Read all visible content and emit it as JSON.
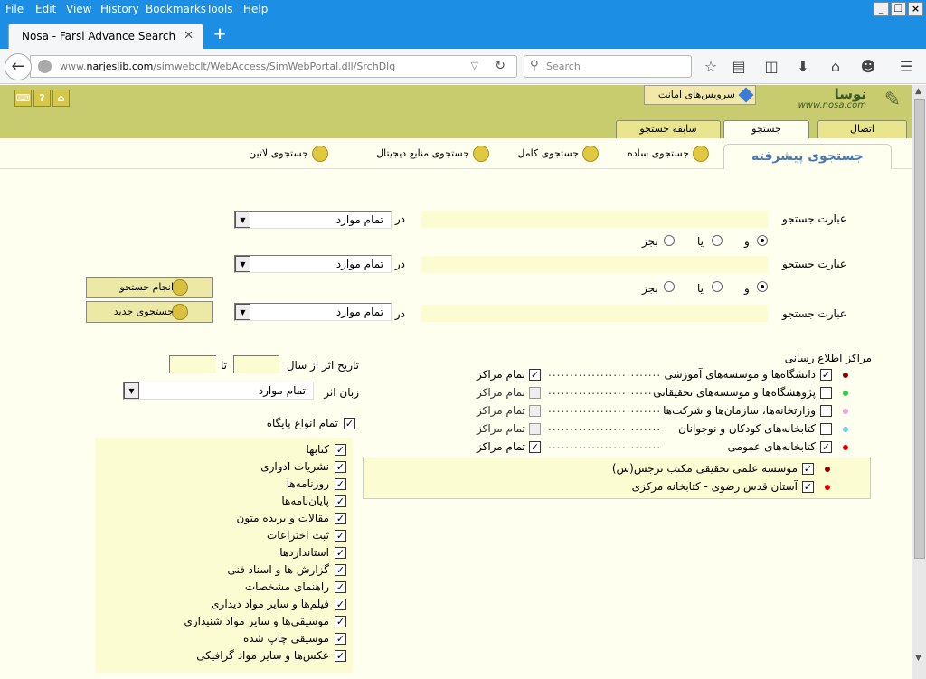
{
  "browser": {
    "menu": [
      "File",
      "Edit",
      "View",
      "History",
      "Bookmarks",
      "Tools",
      "Help"
    ],
    "tab_title": "Nosa - Farsi Advance Search",
    "url_prefix": "www.",
    "url_domain": "narjeslib.com",
    "url_path": "/simwebclt/WebAccess/SimWebPortal.dll/SrchDlg",
    "search_placeholder": "Search"
  },
  "header": {
    "services_button": "سرویس‌های امانت",
    "logo_name": "نوسا",
    "logo_url": "www.nosa.com"
  },
  "page_tabs": {
    "connect": "اتصال",
    "search": "جستجو",
    "history": "سابقه جستجو"
  },
  "advanced_title": "جستجوی پیشرفته",
  "search_links": {
    "simple": "جستجوی ساده",
    "full": "جستجوی کامل",
    "digital": "جستجوی منابع دیجیتال",
    "latin": "جستجوی لاتین"
  },
  "query": {
    "term_label": "عبارت جستجو",
    "in_label": "در",
    "field_value": "تمام موارد",
    "op_and": "و",
    "op_or": "یا",
    "op_not": "بجز"
  },
  "buttons": {
    "do_search": "انجام جستجو",
    "new_search": "جستجوی جدید"
  },
  "filters": {
    "date_label": "تاریخ اثر از سال",
    "to_label": "تا",
    "language_label": "زبان اثر",
    "language_value": "تمام موارد",
    "all_db_types": "تمام انواع پایگاه"
  },
  "db_types": [
    "کتابها",
    "نشریات ادواری",
    "روزنامه‌ها",
    "پایان‌نامه‌ها",
    "مقالات و بریده متون",
    "ثبت اختراعات",
    "استانداردها",
    "گزارش ها و اسناد فنی",
    "راهنمای مشخصات",
    "فیلم‌ها و سایر مواد دیداری",
    "موسیقی‌ها و سایر مواد شنیداری",
    "موسیقی چاپ شده",
    "عکس‌ها و سایر مواد گرافیکی"
  ],
  "centers": {
    "title": "مراکز اطلاع رسانی",
    "all_label": "تمام مراکز",
    "rows": [
      {
        "label": "دانشگاه‌ها و موسسه‌های آموزشی",
        "color": "#8b0000",
        "checked": true,
        "all_checked": true,
        "all_enabled": true
      },
      {
        "label": "پژوهشگاه‌ها و موسسه‌های تحقیقاتی",
        "color": "#2ecc40",
        "checked": false,
        "all_checked": false,
        "all_enabled": false
      },
      {
        "label": "وزارتخانه‌ها، سازمان‌ها و شرکت‌ها",
        "color": "#f0a0e0",
        "checked": false,
        "all_checked": false,
        "all_enabled": false
      },
      {
        "label": "کتابخانه‌های کودکان و نوجوانان",
        "color": "#6cd0f0",
        "checked": false,
        "all_checked": false,
        "all_enabled": false
      },
      {
        "label": "کتابخانه‌های عمومی",
        "color": "#e00000",
        "checked": true,
        "all_checked": true,
        "all_enabled": true
      }
    ],
    "subs": [
      {
        "label": "موسسه علمی تحقیقی مکتب نرجس(س)",
        "color": "#8b0000"
      },
      {
        "label": "آستان قدس رضوی - کتابخانه مرکزی",
        "color": "#e00000"
      }
    ]
  }
}
